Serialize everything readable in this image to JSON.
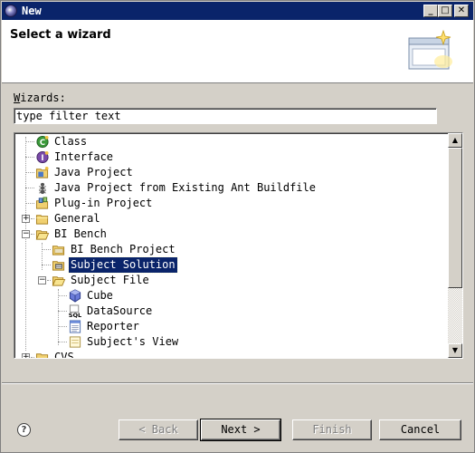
{
  "window": {
    "title": "New",
    "controls": {
      "minimize": "_",
      "maximize": "□",
      "close": "✕"
    }
  },
  "banner": {
    "title": "Select a wizard",
    "graphic_icon": "new-wizard-graphic"
  },
  "filter": {
    "label_accesskey": "W",
    "label_rest": "izards:",
    "value": "type filter text"
  },
  "tree": {
    "items": [
      {
        "label": "Class",
        "icon": "class-icon"
      },
      {
        "label": "Interface",
        "icon": "interface-icon"
      },
      {
        "label": "Java Project",
        "icon": "java-project-icon"
      },
      {
        "label": "Java Project from Existing Ant Buildfile",
        "icon": "ant-icon"
      },
      {
        "label": "Plug-in Project",
        "icon": "plugin-project-icon"
      },
      {
        "label": "General",
        "icon": "folder-icon",
        "expander": "+"
      },
      {
        "label": "BI Bench",
        "icon": "folder-open-icon",
        "expander": "−"
      },
      {
        "label": "BI Bench Project",
        "icon": "project-folder-icon"
      },
      {
        "label": "Subject Solution",
        "icon": "subject-solution-icon",
        "selected": true
      },
      {
        "label": "Subject File",
        "icon": "folder-open-icon",
        "expander": "−"
      },
      {
        "label": "Cube",
        "icon": "cube-icon"
      },
      {
        "label": "DataSource",
        "icon": "sql-icon"
      },
      {
        "label": "Reporter",
        "icon": "reporter-icon"
      },
      {
        "label": "Subject's View",
        "icon": "view-icon"
      },
      {
        "label": "CVS",
        "icon": "folder-icon",
        "expander": "+"
      }
    ]
  },
  "buttons": {
    "help": "?",
    "back": "< Back",
    "back_accesskey": "B",
    "next": "Next >",
    "next_accesskey": "N",
    "finish": "Finish",
    "finish_accesskey": "F",
    "cancel": "Cancel"
  },
  "colors": {
    "titlebar": "#0a246a",
    "selection": "#0a246a",
    "chrome": "#d4d0c8"
  }
}
